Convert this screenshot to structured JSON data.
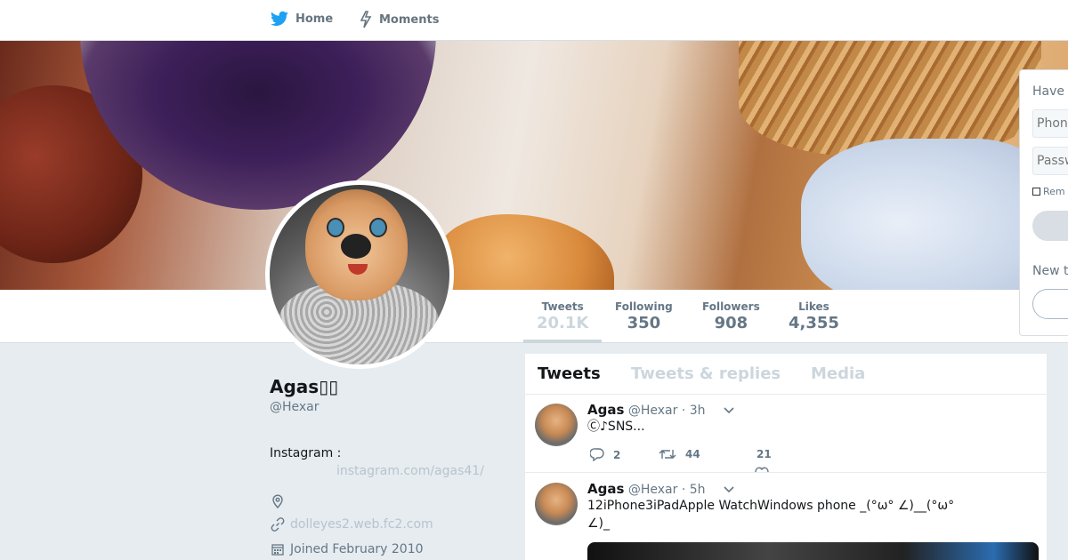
{
  "nav": {
    "home_label": "Home",
    "moments_label": "Moments"
  },
  "profile": {
    "name": "Agas▯▯",
    "handle": "@Hexar",
    "bio": "Instagram :",
    "bio_link": "instagram.com/agas41/",
    "location": "",
    "website": "dolleyes2.web.fc2.com",
    "joined": "Joined February 2010"
  },
  "stats": [
    {
      "label": "Tweets",
      "value": "20.1K",
      "active": true
    },
    {
      "label": "Following",
      "value": "350"
    },
    {
      "label": "Followers",
      "value": "908"
    },
    {
      "label": "Likes",
      "value": "4,355"
    }
  ],
  "timeline": {
    "tabs": [
      "Tweets",
      "Tweets & replies",
      "Media"
    ],
    "tweets": [
      {
        "name": "Agas",
        "handle": "@Hexar",
        "time": "· 3h",
        "text": "Ⓒ♪SNS...",
        "replies": "2",
        "retweets": "44",
        "likes": "21"
      },
      {
        "name": "Agas",
        "handle": "@Hexar",
        "time": "· 5h",
        "text": "12iPhone3iPadApple WatchWindows  phone _(°ω° ∠)__(°ω° ∠)_"
      }
    ]
  },
  "login": {
    "heading": "Have",
    "phone_placeholder": "Phon",
    "password_placeholder": "Passw",
    "remember": "Rem",
    "new_heading": "New t"
  },
  "colors": {
    "brand": "#1da1f2",
    "background": "#e6ecf0"
  },
  "icons": {
    "home": "bird-icon",
    "moments": "lightning-icon",
    "location": "location-pin-icon",
    "website": "link-icon",
    "joined": "calendar-icon",
    "reply": "reply-icon",
    "retweet": "retweet-icon",
    "like": "heart-icon",
    "caret": "chevron-down-icon"
  }
}
